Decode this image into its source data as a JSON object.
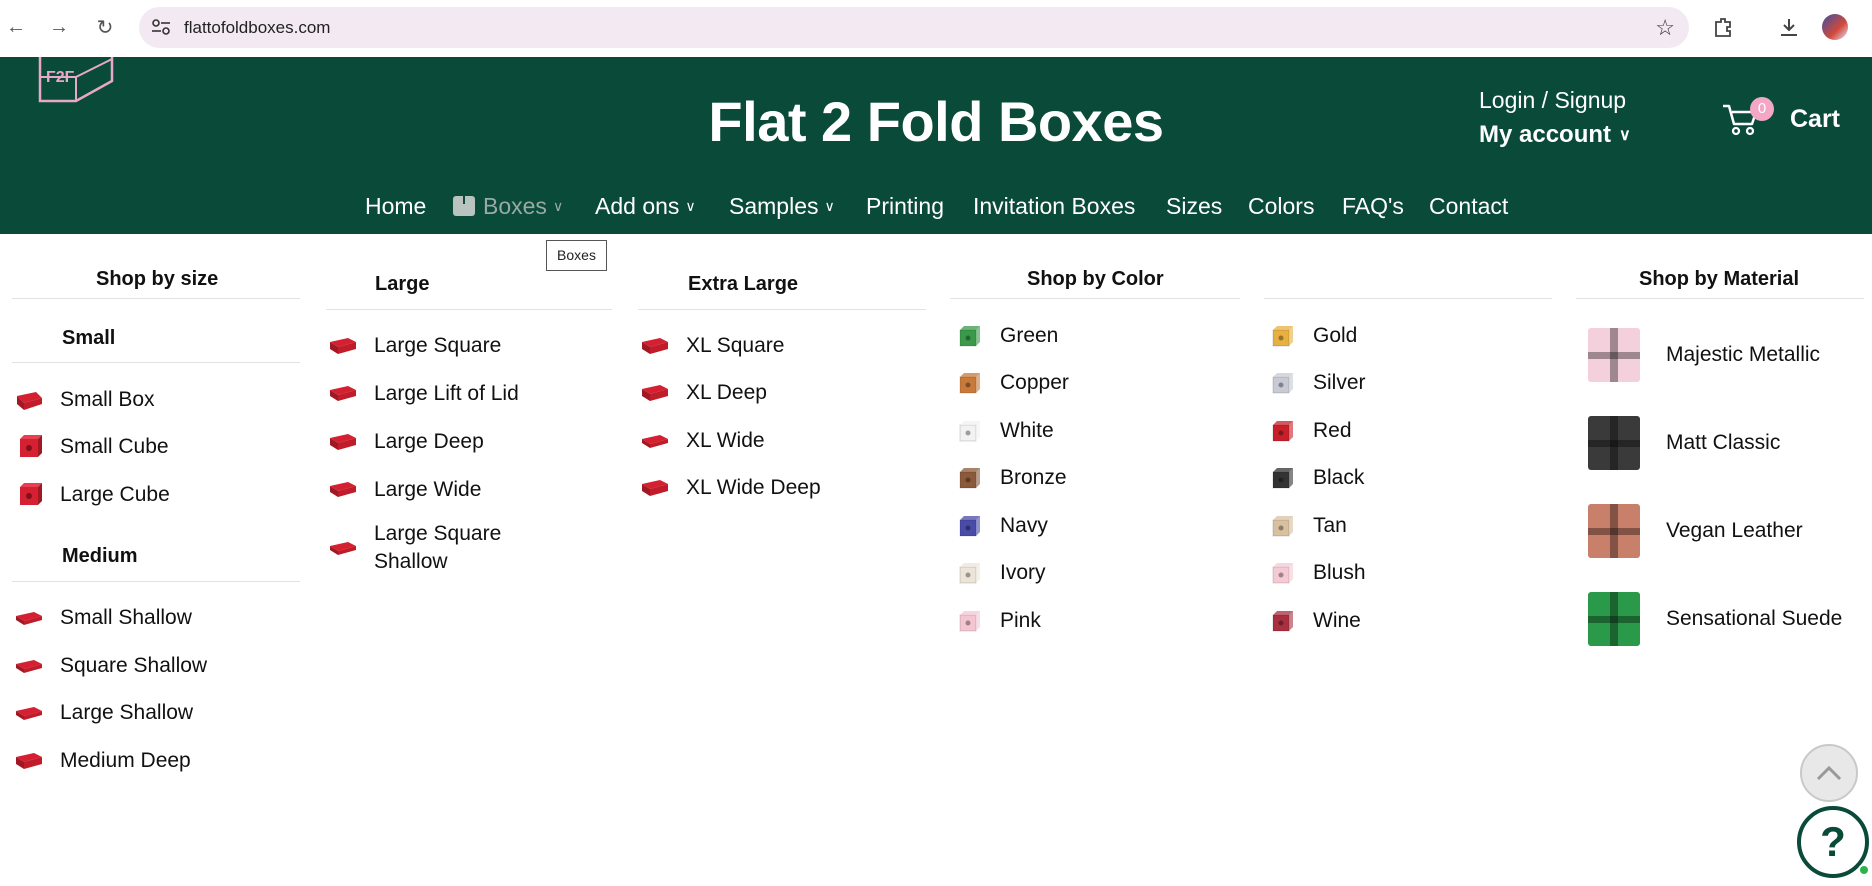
{
  "browser": {
    "url": "flattofoldboxes.com"
  },
  "header": {
    "logo_text": "F2F",
    "title": "Flat 2 Fold Boxes",
    "login_label": "Login / Signup",
    "account_label": "My account",
    "cart_count": "0",
    "cart_label": "Cart"
  },
  "nav": {
    "items": [
      {
        "label": "Home"
      },
      {
        "label": "Boxes"
      },
      {
        "label": "Add ons"
      },
      {
        "label": "Samples"
      },
      {
        "label": "Printing"
      },
      {
        "label": "Invitation Boxes"
      },
      {
        "label": "Sizes"
      },
      {
        "label": "Colors"
      },
      {
        "label": "FAQ's"
      },
      {
        "label": "Contact"
      }
    ],
    "tooltip": "Boxes"
  },
  "menu": {
    "shop_by_size": {
      "heading": "Shop by size",
      "small_heading": "Small",
      "small_items": [
        "Small Box",
        "Small Cube",
        "Large Cube"
      ],
      "medium_heading": "Medium",
      "medium_items": [
        "Small Shallow",
        "Square Shallow",
        "Large Shallow",
        "Medium Deep"
      ]
    },
    "large": {
      "heading": "Large",
      "items": [
        "Large Square",
        "Large Lift of Lid",
        "Large Deep",
        "Large Wide",
        "Large Square Shallow"
      ]
    },
    "extra_large": {
      "heading": "Extra Large",
      "items": [
        "XL Square",
        "XL Deep",
        "XL Wide",
        "XL Wide Deep"
      ]
    },
    "shop_by_color": {
      "heading": "Shop by Color",
      "col1": [
        {
          "label": "Green",
          "color": "#3a9a4a"
        },
        {
          "label": "Copper",
          "color": "#c87a3a"
        },
        {
          "label": "White",
          "color": "#f2f2f2"
        },
        {
          "label": "Bronze",
          "color": "#8a5a3a"
        },
        {
          "label": "Navy",
          "color": "#4a4aa8"
        },
        {
          "label": "Ivory",
          "color": "#ece4d8"
        },
        {
          "label": "Pink",
          "color": "#f4c6d4"
        }
      ],
      "col2": [
        {
          "label": "Gold",
          "color": "#e8b040"
        },
        {
          "label": "Silver",
          "color": "#c8cad4"
        },
        {
          "label": "Red",
          "color": "#c8202a"
        },
        {
          "label": "Black",
          "color": "#333333"
        },
        {
          "label": "Tan",
          "color": "#d8c0a0"
        },
        {
          "label": "Blush",
          "color": "#f4cad4"
        },
        {
          "label": "Wine",
          "color": "#a83040"
        }
      ]
    },
    "shop_by_material": {
      "heading": "Shop by Material",
      "items": [
        {
          "label": "Majestic Metallic",
          "color": "#f4d0dc"
        },
        {
          "label": "Matt Classic",
          "color": "#3a3a3a"
        },
        {
          "label": "Vegan Leather",
          "color": "#c8806a"
        },
        {
          "label": "Sensational Suede",
          "color": "#2a9a4a"
        }
      ]
    }
  }
}
